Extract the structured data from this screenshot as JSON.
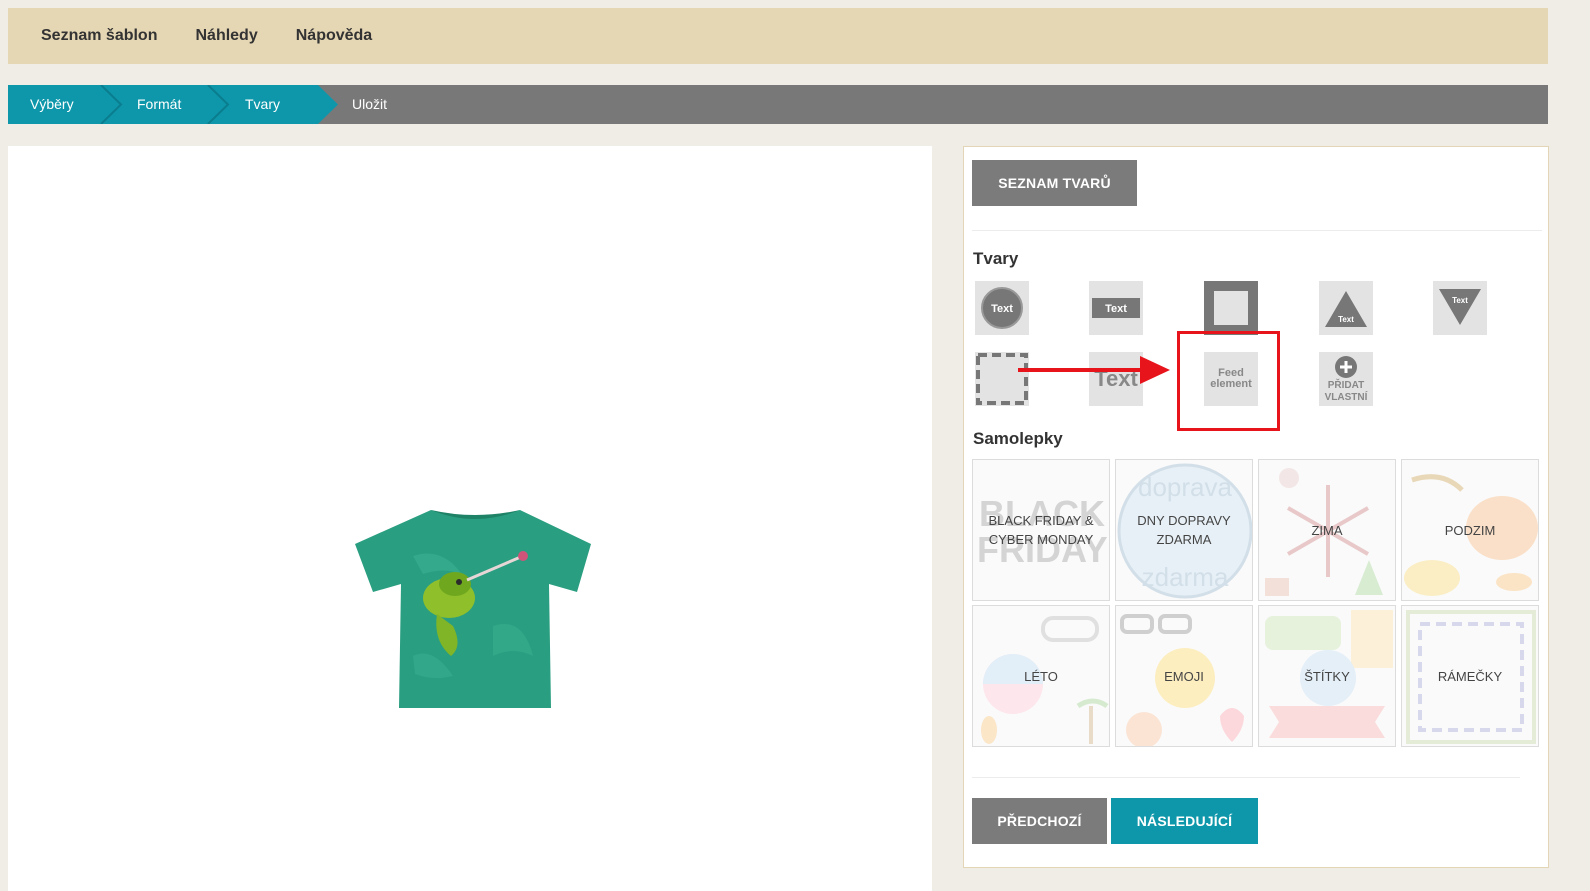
{
  "topnav": {
    "items": [
      "Seznam šablon",
      "Náhledy",
      "Nápověda"
    ]
  },
  "steps": {
    "items": [
      "Výběry",
      "Formát",
      "Tvary",
      "Uložit"
    ],
    "active_color": "#0e97aa",
    "inactive_color": "#787878"
  },
  "panel": {
    "list_button": "SEZNAM TVARŮ",
    "shapes_title": "Tvary",
    "stickers_title": "Samolepky",
    "shapes": {
      "circle_text": "Text",
      "rect_text": "Text",
      "triangle_text": "Text",
      "inverted_triangle_text": "Text",
      "plain_text": "Text",
      "feed_line1": "Feed",
      "feed_line2": "element",
      "add_line1": "PŘIDAT",
      "add_line2": "VLASTNÍ"
    },
    "stickers": {
      "black_friday": "BLACK FRIDAY & CYBER MONDAY",
      "free_shipping": "DNY DOPRAVY ZDARMA",
      "winter": "ZIMA",
      "autumn": "PODZIM",
      "summer": "LÉTO",
      "emoji": "EMOJI",
      "tags": "ŠTÍTKY",
      "frames": "RÁMEČKY"
    },
    "sticker_bg_text": {
      "black_friday_1": "BLACK",
      "black_friday_2": "FRIDAY",
      "shipping_1": "doprava",
      "shipping_2": "zdarma"
    },
    "prev_button": "PŘEDCHOZÍ",
    "next_button": "NÁSLEDUJÍCÍ"
  },
  "colors": {
    "accent": "#0e97aa",
    "highlight": "#e8141b",
    "topnav_bg": "#e5d7b4"
  }
}
